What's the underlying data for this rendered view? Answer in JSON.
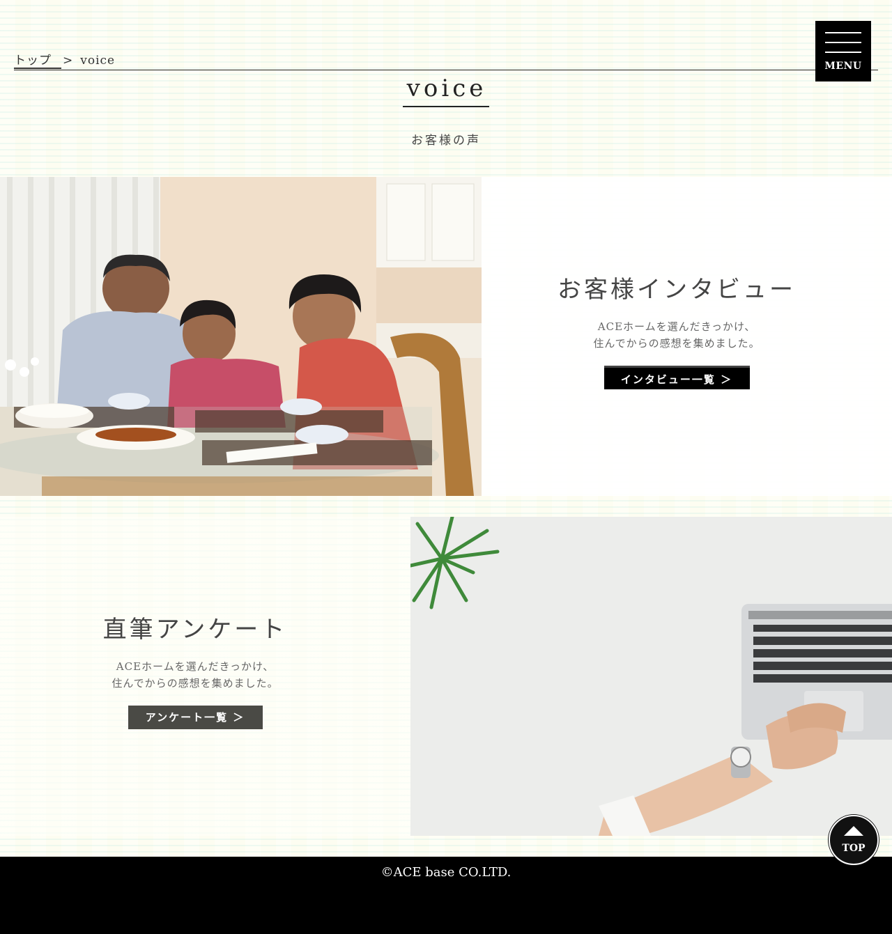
{
  "breadcrumb": {
    "home": "トップ",
    "separator": ">",
    "current": "voice"
  },
  "menu": {
    "label": "MENU"
  },
  "page": {
    "title": "voice",
    "subtitle": "お客様の声"
  },
  "sections": [
    {
      "heading": "お客様インタビュー",
      "line1": "ACEホームを選んだきっかけ、",
      "line2": "住んでからの感想を集めました。",
      "button": "インタビュー一覧 ＞"
    },
    {
      "heading": "直筆アンケート",
      "line1": "ACEホームを選んだきっかけ、",
      "line2": "住んでからの感想を集めました。",
      "button": "アンケート一覧 ＞"
    }
  ],
  "footer": {
    "copyright": "©ACE base CO.LTD."
  },
  "top_button": {
    "label": "TOP"
  },
  "colors": {
    "background": "#fdfdf1",
    "black": "#000000",
    "button_gray": "#4a4a45"
  }
}
